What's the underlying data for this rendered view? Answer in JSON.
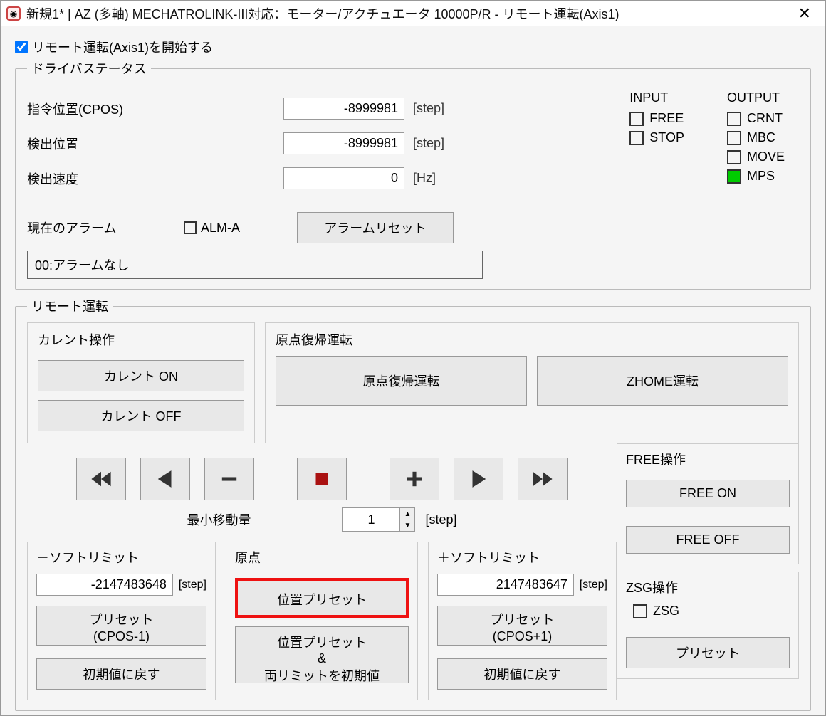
{
  "window": {
    "title": "新規1* | AZ (多軸) MECHATROLINK-III対応：モーター/アクチュエータ 10000P/R - リモート運転(Axis1)"
  },
  "start": {
    "label": "リモート運転(Axis1)を開始する",
    "checked": true
  },
  "driver_status": {
    "legend": "ドライバステータス",
    "cpos_label": "指令位置(CPOS)",
    "cpos_value": "-8999981",
    "cpos_unit": "[step]",
    "detect_label": "検出位置",
    "detect_value": "-8999981",
    "detect_unit": "[step]",
    "speed_label": "検出速度",
    "speed_value": "0",
    "speed_unit": "[Hz]",
    "alarm_label": "現在のアラーム",
    "alma_label": "ALM-A",
    "alarm_reset_btn": "アラームリセット",
    "alarm_text": "00:アラームなし",
    "input_title": "INPUT",
    "input_items": [
      {
        "label": "FREE",
        "on": false
      },
      {
        "label": "STOP",
        "on": false
      }
    ],
    "output_title": "OUTPUT",
    "output_items": [
      {
        "label": "CRNT",
        "on": false
      },
      {
        "label": "MBC",
        "on": false
      },
      {
        "label": "MOVE",
        "on": false
      },
      {
        "label": "MPS",
        "on": true
      }
    ]
  },
  "remote": {
    "legend": "リモート運転",
    "current_title": "カレント操作",
    "current_on": "カレント ON",
    "current_off": "カレント OFF",
    "home_title": "原点復帰運転",
    "home_btn": "原点復帰運転",
    "zhome_btn": "ZHOME運転",
    "minmove_label": "最小移動量",
    "minmove_value": "1",
    "minmove_unit": "[step]",
    "softlimit_neg_title": "－ソフトリミット",
    "softlimit_neg_value": "-2147483648",
    "softlimit_neg_unit": "[step]",
    "preset_neg_btn": "プリセット\n(CPOS-1)",
    "reset_default_btn": "初期値に戻す",
    "origin_title": "原点",
    "pos_preset_btn": "位置プリセット",
    "pos_preset_both_btn": "位置プリセット\n&\n両リミットを初期値",
    "softlimit_pos_title": "＋ソフトリミット",
    "softlimit_pos_value": "2147483647",
    "softlimit_pos_unit": "[step]",
    "preset_pos_btn": "プリセット\n(CPOS+1)",
    "free_title": "FREE操作",
    "free_on": "FREE ON",
    "free_off": "FREE OFF",
    "zsg_title": "ZSG操作",
    "zsg_label": "ZSG",
    "zsg_preset": "プリセット"
  }
}
